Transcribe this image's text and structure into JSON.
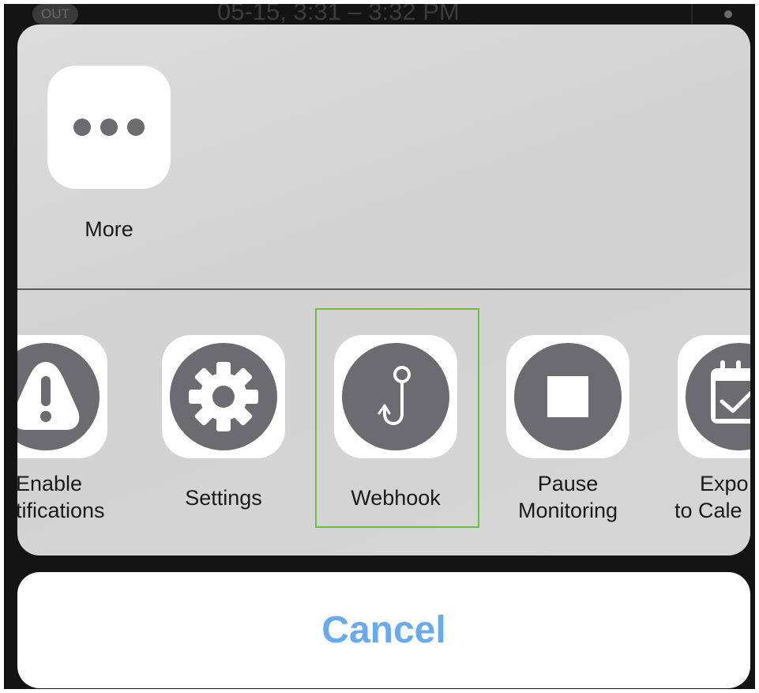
{
  "background": {
    "badge": "OUT",
    "time_range": "05-15, 3:31 – 3:32 PM"
  },
  "share_sheet": {
    "top_actions": [
      {
        "label": "More",
        "icon": "ellipsis-icon"
      }
    ],
    "bottom_actions": [
      {
        "label_line1": "Enable",
        "label_line2": "tifications",
        "icon": "alert-icon"
      },
      {
        "label_line1": "Settings",
        "icon": "gear-icon"
      },
      {
        "label_line1": "Webhook",
        "icon": "hook-icon"
      },
      {
        "label_line1": "Pause",
        "label_line2": "Monitoring",
        "icon": "stop-icon"
      },
      {
        "label_line1": "Expo",
        "label_line2": "to Cale",
        "icon": "calendar-check-icon"
      }
    ],
    "selected": "Webhook"
  },
  "cancel_label": "Cancel",
  "colors": {
    "icon_gray": "#6b6b70",
    "accent_blue": "#68aaf0",
    "highlight_green": "#6dbb4e"
  }
}
